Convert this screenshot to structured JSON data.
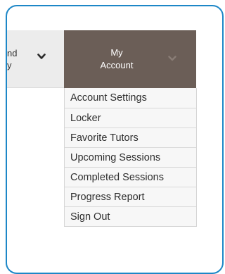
{
  "nav": {
    "left_item": {
      "line1": "nd",
      "line2": "y"
    },
    "account": {
      "line1": "My",
      "line2": "Account"
    }
  },
  "icons": {
    "left_chevron": "chevron-down-icon",
    "account_chevron": "chevron-down-icon"
  },
  "colors": {
    "frame_border": "#1d87c7",
    "account_bg": "#6b5e57",
    "nav_bg": "#ececec",
    "menu_bg": "#f7f7f7"
  },
  "menu": {
    "items": [
      {
        "label": "Account Settings"
      },
      {
        "label": "Locker"
      },
      {
        "label": "Favorite Tutors"
      },
      {
        "label": "Upcoming Sessions"
      },
      {
        "label": "Completed Sessions"
      },
      {
        "label": "Progress Report"
      },
      {
        "label": "Sign Out"
      }
    ]
  }
}
